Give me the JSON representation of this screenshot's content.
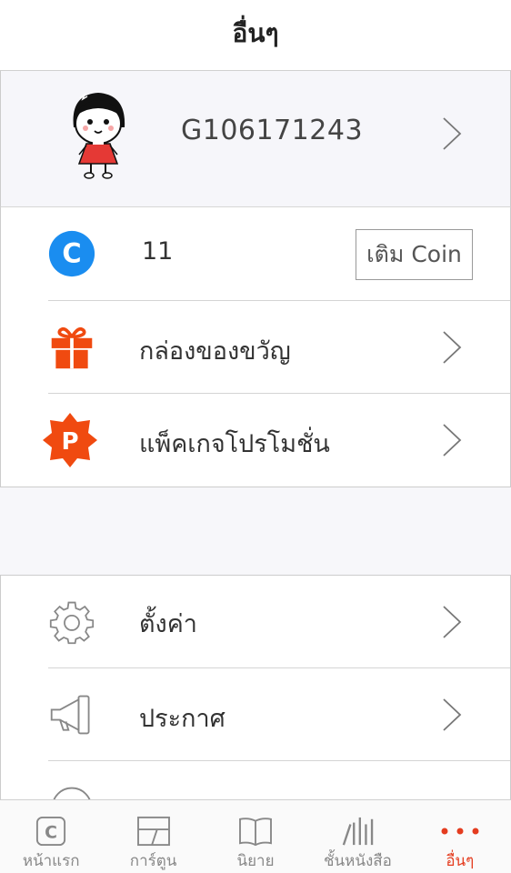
{
  "header": {
    "title": "อื่นๆ"
  },
  "profile": {
    "user_id": "G106171243"
  },
  "wallet": {
    "coin_balance": "11",
    "topup_label": "เติม Coin",
    "gift_box_label": "กล่องของขวัญ",
    "promo_package_label": "แพ็คเกจโปรโมชั่น",
    "coin_icon_letter": "C",
    "promo_icon_letter": "P"
  },
  "settings": {
    "settings_label": "ตั้งค่า",
    "announcement_label": "ประกาศ"
  },
  "tabbar": {
    "tabs": [
      {
        "label": "หน้าแรก",
        "icon": "home-c-icon"
      },
      {
        "label": "การ์ตูน",
        "icon": "comic-panel-icon"
      },
      {
        "label": "นิยาย",
        "icon": "book-icon"
      },
      {
        "label": "ชั้นหนังสือ",
        "icon": "bookshelf-icon"
      },
      {
        "label": "อื่นๆ",
        "icon": "more-dots-icon"
      }
    ],
    "active_index": 4,
    "home_icon_letter": "C"
  },
  "colors": {
    "accent": "#e43c1f",
    "coin_blue": "#1a8df0",
    "gift_orange": "#f04a10"
  }
}
